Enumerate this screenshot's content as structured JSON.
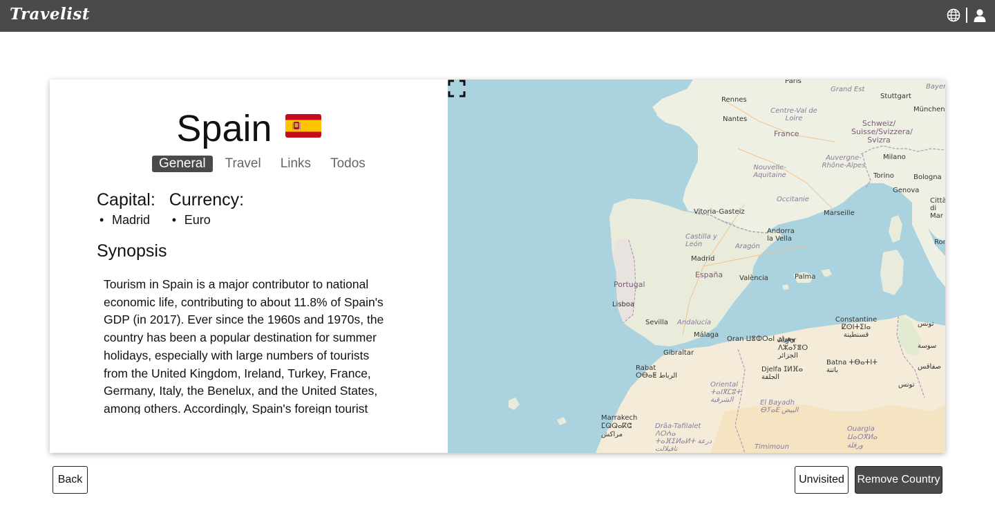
{
  "app": {
    "brand": "Travelist"
  },
  "navbar": {
    "icons": [
      "globe-icon",
      "user-icon"
    ]
  },
  "country": {
    "name": "Spain",
    "flag_icon": "spain-flag-icon",
    "tabs": [
      {
        "label": "General",
        "active": true
      },
      {
        "label": "Travel",
        "active": false
      },
      {
        "label": "Links",
        "active": false
      },
      {
        "label": "Todos",
        "active": false
      }
    ],
    "capital_label": "Capital:",
    "capital_value": "Madrid",
    "currency_label": "Currency:",
    "currency_value": "Euro",
    "synopsis_label": "Synopsis",
    "synopsis_text": "Tourism in Spain is a major contributor to national economic life, contributing to about 11.8% of Spain's GDP (in 2017). Ever since the 1960s and 1970s, the country has been a popular destination for summer holidays, especially with large numbers of tourists from the United Kingdom, Ireland, Turkey, France, Germany, Italy, the Benelux, and the United States, among others. Accordingly, Spain's foreign tourist"
  },
  "map": {
    "labels": {
      "paris": "Paris",
      "grand_est": "Grand Est",
      "stuttgart": "Stuttgart",
      "bayern": "Bayern",
      "rennes": "Rennes",
      "centre": "Centre-Val de Loire",
      "nantes": "Nantes",
      "munchen": "München",
      "france": "France",
      "schweiz": "Schweiz/ Suisse/Svizzera/ Svizra",
      "auvergne": "Auvergne- Rhône-Alpes",
      "milano": "Milano",
      "nouvelle": "Nouvelle- Aquitaine",
      "torino": "Torino",
      "bologna": "Bologna",
      "genova": "Genova",
      "occitanie": "Occitanie",
      "citta": "Città di Mar",
      "vitoria": "Vitoria-Gasteiz",
      "marseille": "Marseille",
      "andorra": "Andorra la Vella",
      "castilla": "Castilla y León",
      "aragon": "Aragón",
      "rom": "Rom",
      "madrid": "Madrid",
      "espana": "España",
      "valencia": "València",
      "palma": "Palma",
      "portugal": "Portugal",
      "lisboa": "Lisboa",
      "sevilla": "Sevilla",
      "andalucia": "Andalucía",
      "constantine": "Constantine ⵇⵙⵏⵜⵉⵏⴰ قسنطينة",
      "malaga": "Málaga",
      "oran": "Oran ⵡⴻⵀⵔⴰⵏ وهران",
      "alger": "Alger ⴷⵣⴰⵢⴻⵔ الجزائر",
      "tunis": "تونس",
      "gibraltar": "Gibraltar",
      "sousse": "سوسة",
      "batna": "Batna ⵜⴱⴰⵜⵏⵜ باتنة",
      "rabat": "Rabat ⵔⴱⴰⵟ الرباط",
      "djelfa": "Djelfa ⵊⵍⴼⴰ الجلفة",
      "sfax": "صفاقس",
      "oriental": "Oriental ⵜⴰⵏⴳⵎⵓⵜ الشرقية",
      "tunisia": "تونس",
      "bayadh": "El Bayadh ⴱⵢⴰⴹ البيض",
      "marrakech": "Marrakech ⵎⵕⵕⴰⴽⵛ مراكش",
      "draa": "Drâa-Tafilalet ⴷⵔⵄⴰ ⵜⴰⴼⵉⵍⴰⵍⵜ درعة تافيلالت",
      "ouargla": "Ouargla ⵡⴰⵔⴳⵍⴰ ورقلة",
      "timimoun": "Timimoun"
    }
  },
  "actions": {
    "back": "Back",
    "unvisited": "Unvisited",
    "remove": "Remove Country"
  }
}
